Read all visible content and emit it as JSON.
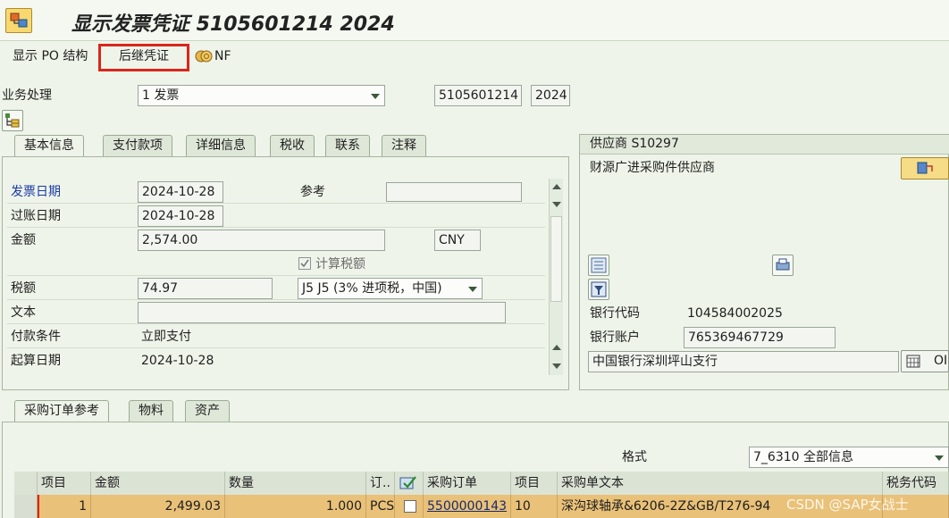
{
  "title": "显示发票凭证 5105601214 2024",
  "toolbar": {
    "po_structure": "显示 PO 结构",
    "follow_on_docs": "后继凭证",
    "nf": "NF"
  },
  "header": {
    "transaction_label": "业务处理",
    "transaction_value": "1 发票",
    "doc_number": "5105601214",
    "fiscal_year": "2024"
  },
  "tabs": [
    "基本信息",
    "支付款项",
    "详细信息",
    "税收",
    "联系",
    "注释"
  ],
  "basic": {
    "invoice_date_label": "发票日期",
    "invoice_date": "2024-10-28",
    "reference_label": "参考",
    "reference": "",
    "posting_date_label": "过账日期",
    "posting_date": "2024-10-28",
    "amount_label": "金额",
    "amount": "2,574.00",
    "currency": "CNY",
    "calc_tax_label": "计算税额",
    "tax_amount_label": "税额",
    "tax_amount": "74.97",
    "tax_code": "J5 J5 (3% 进项税，中国)",
    "text_label": "文本",
    "text": "",
    "payment_terms_label": "付款条件",
    "payment_terms": "立即支付",
    "baseline_date_label": "起算日期",
    "baseline_date": "2024-10-28"
  },
  "vendor": {
    "header": "供应商 S10297",
    "name": "财源广进采购件供应商",
    "bank_code_label": "银行代码",
    "bank_code": "104584002025",
    "bank_account_label": "银行账户",
    "bank_account": "765369467729",
    "bank_name": "中国银行深圳坪山支行",
    "oi_button": "OI"
  },
  "lower_tabs": [
    "采购订单参考",
    "物料",
    "资产"
  ],
  "layout": {
    "label": "格式",
    "value": "7_6310 全部信息"
  },
  "grid": {
    "headers": [
      "项目",
      "金额",
      "数量",
      "订..",
      "",
      "采购订单",
      "项目",
      "采购单文本",
      "税务代码"
    ],
    "row": {
      "item": "1",
      "amount": "2,499.03",
      "quantity": "1.000",
      "unit": "PCS",
      "po": "5500000143",
      "po_item": "10",
      "po_text": "深沟球轴承&6206-2Z&GB/T276-94",
      "tax_code": ""
    }
  },
  "watermark": "CSDN @SAP女战士",
  "colors": {
    "accent_highlight": "#d9261c",
    "row_highlight": "#e9c178",
    "background": "#eef4e9"
  }
}
